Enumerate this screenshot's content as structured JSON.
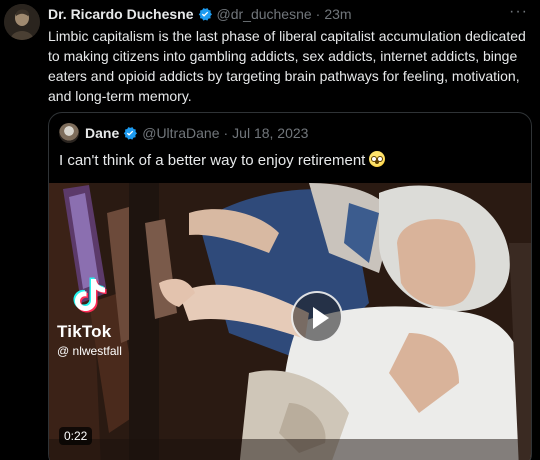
{
  "tweet": {
    "author_name": "Dr. Ricardo Duchesne",
    "handle": "@dr_duchesne",
    "separator": "·",
    "time": "23m",
    "more_icon": "more-horizontal-icon",
    "text": "Limbic capitalism is the last phase of liberal capitalist accumulation dedicated to making citizens into gambling addicts, sex addicts, internet addicts, binge eaters and opioid addicts by targeting brain pathways for feeling, motivation, and long-term memory."
  },
  "quoted": {
    "author_name": "Dane",
    "handle": "@UltraDane",
    "separator": "·",
    "date": "Jul 18, 2023",
    "text": "I can't think of a better way to enjoy retirement",
    "emoji_icon": "flushed-face-emoji",
    "video": {
      "watermark_brand": "TikTok",
      "watermark_user": "@ nlwestfall",
      "duration": "0:22",
      "play_icon": "play-icon"
    }
  },
  "colors": {
    "background": "#000000",
    "text_primary": "#e7e9ea",
    "text_secondary": "#71767b",
    "verified_blue": "#1d9bf0",
    "border": "#2f3336"
  }
}
